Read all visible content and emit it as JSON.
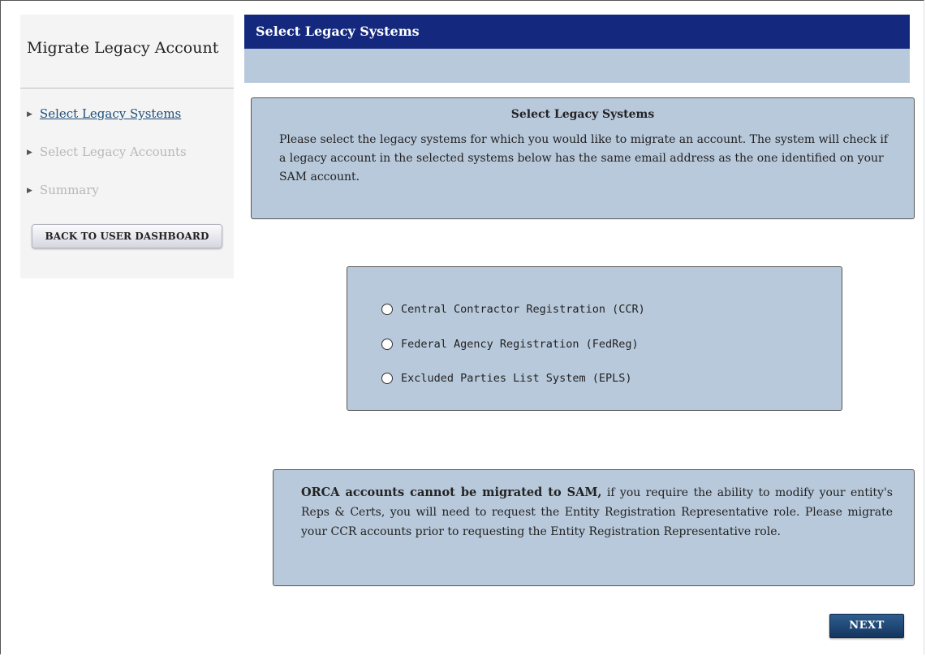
{
  "sidebar": {
    "title": "Migrate Legacy Account",
    "items": [
      {
        "label": "Select Legacy Systems",
        "state": "active"
      },
      {
        "label": "Select Legacy Accounts",
        "state": "disabled"
      },
      {
        "label": "Summary",
        "state": "disabled"
      }
    ],
    "back_button": "BACK TO USER DASHBOARD"
  },
  "header": {
    "title": "Select Legacy Systems"
  },
  "info": {
    "title": "Select Legacy Systems",
    "body": "Please select the legacy systems for which you would like to migrate an account. The system will check if a legacy account in the selected systems below has the same email address as the one identified on your SAM account."
  },
  "systems": [
    {
      "label": "Central Contractor Registration (CCR)",
      "selected": false
    },
    {
      "label": "Federal Agency Registration (FedReg)",
      "selected": false
    },
    {
      "label": "Excluded Parties List System (EPLS)",
      "selected": false
    }
  ],
  "note": {
    "bold": "ORCA accounts cannot be migrated to SAM,",
    "text": " if you require the ability to modify your entity's Reps & Certs, you will need to request the Entity Registration Representative role. Please migrate your CCR accounts prior to requesting the Entity Registration Representative role."
  },
  "next_button": "NEXT",
  "colors": {
    "header": "#14297e",
    "panel": "#b8c9db",
    "link": "#1f4e79",
    "disabled": "#b8b8b8"
  }
}
